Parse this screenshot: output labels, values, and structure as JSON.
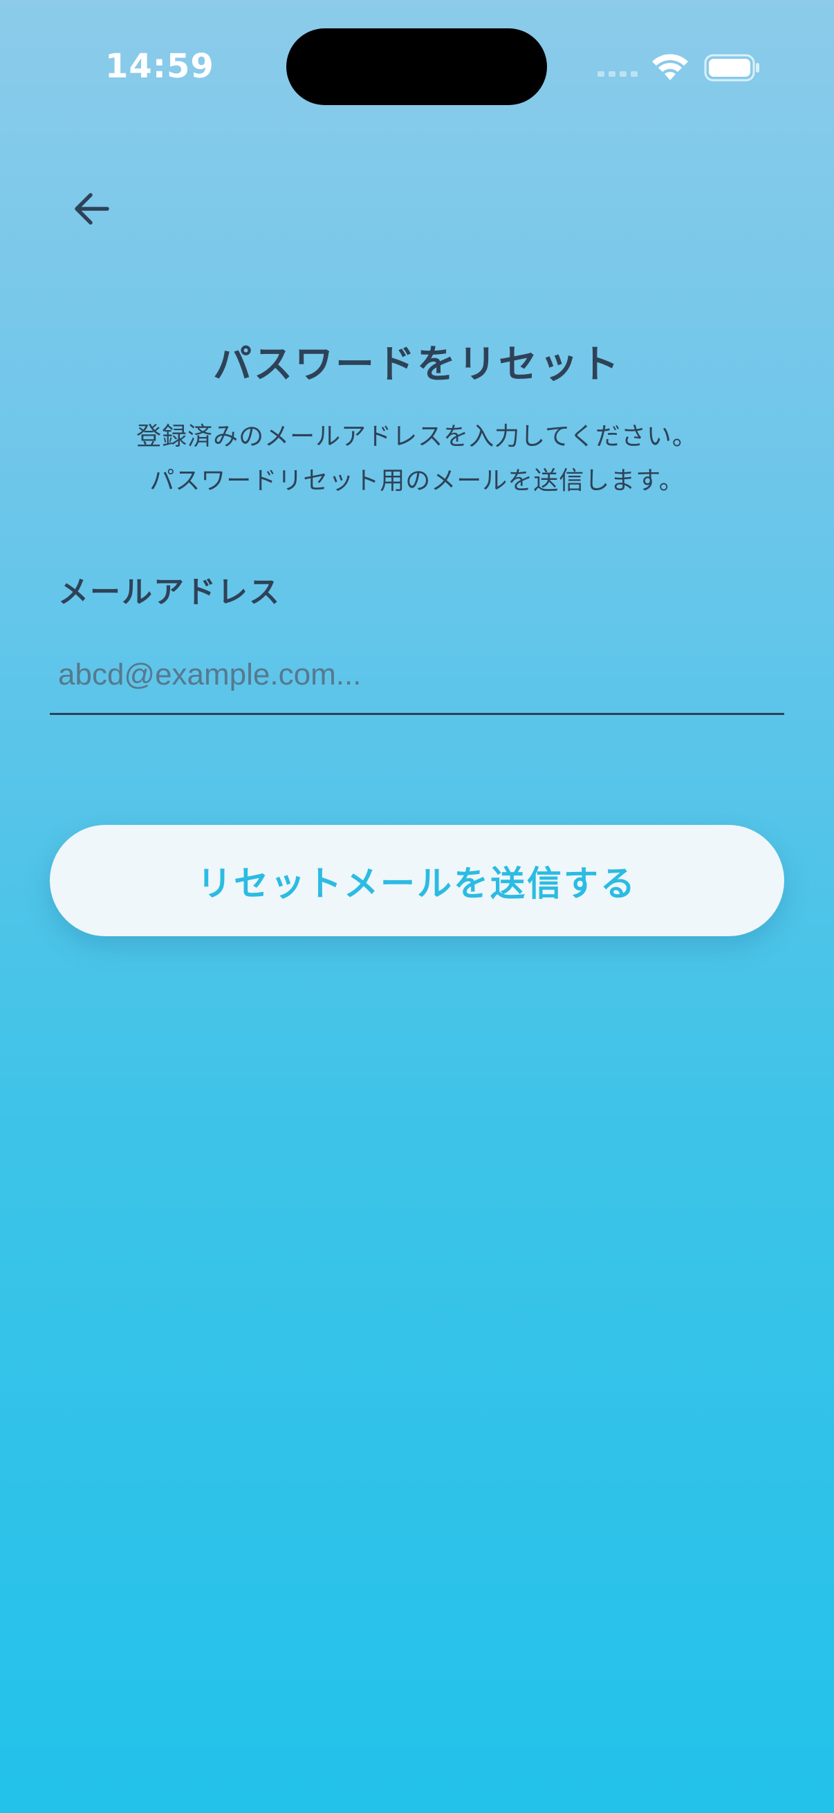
{
  "status_bar": {
    "time": "14:59",
    "icons": [
      "cell-signal-icon",
      "wifi-icon",
      "battery-icon"
    ]
  },
  "nav": {
    "back_icon": "arrow-left-icon"
  },
  "header": {
    "title": "パスワードをリセット",
    "description_line1": "登録済みのメールアドレスを入力してください。",
    "description_line2": "パスワードリセット用のメールを送信します。"
  },
  "form": {
    "email_label": "メールアドレス",
    "email_placeholder": "abcd@example.com...",
    "email_value": ""
  },
  "actions": {
    "submit_label": "リセットメールを送信する"
  },
  "colors": {
    "background_top": "#8ccbea",
    "background_bottom": "#22c2ea",
    "text_primary": "#2e4257",
    "accent": "#2cbbe2",
    "button_background": "#eff7fa"
  }
}
